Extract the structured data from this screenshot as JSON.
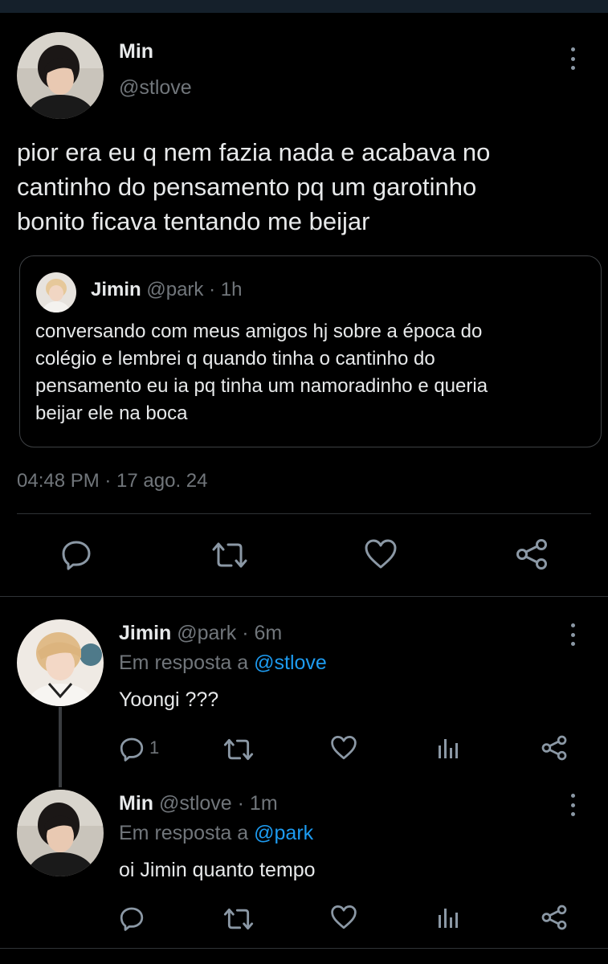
{
  "main_tweet": {
    "author_name": "Min",
    "author_handle": "@stlove",
    "text_lines": [
      "pior era eu q nem fazia nada e acabava no",
      "cantinho do pensamento pq um garotinho",
      "bonito ficava tentando me beijar"
    ],
    "quoted": {
      "author_name": "Jimin",
      "author_handle": "@park",
      "time": "· 1h",
      "text_lines": [
        "conversando com meus amigos hj sobre a época do",
        "colégio e lembrei q quando tinha o cantinho do",
        "pensamento eu ia pq tinha um namoradinho e queria",
        "beijar ele na boca"
      ]
    },
    "timestamp": "04:48 PM · 17 ago. 24",
    "actions": [
      "reply-icon",
      "retweet-icon",
      "like-icon",
      "share-icon"
    ]
  },
  "replies": [
    {
      "author_name": "Jimin",
      "author_handle": "@park",
      "time": "· 6m",
      "reply_prefix": "Em resposta a",
      "reply_to": "@stlove",
      "text": "Yoongi ???",
      "reply_count": "1"
    },
    {
      "author_name": "Min",
      "author_handle": "@stlove",
      "time": "· 1m",
      "reply_prefix": "Em resposta a",
      "reply_to": "@park",
      "text": "oi Jimin quanto tempo",
      "reply_count": ""
    }
  ],
  "colors": {
    "background": "#000000",
    "text": "#e7e9ea",
    "muted": "#71767b",
    "link": "#1d9bf0",
    "border": "#2f3336"
  }
}
